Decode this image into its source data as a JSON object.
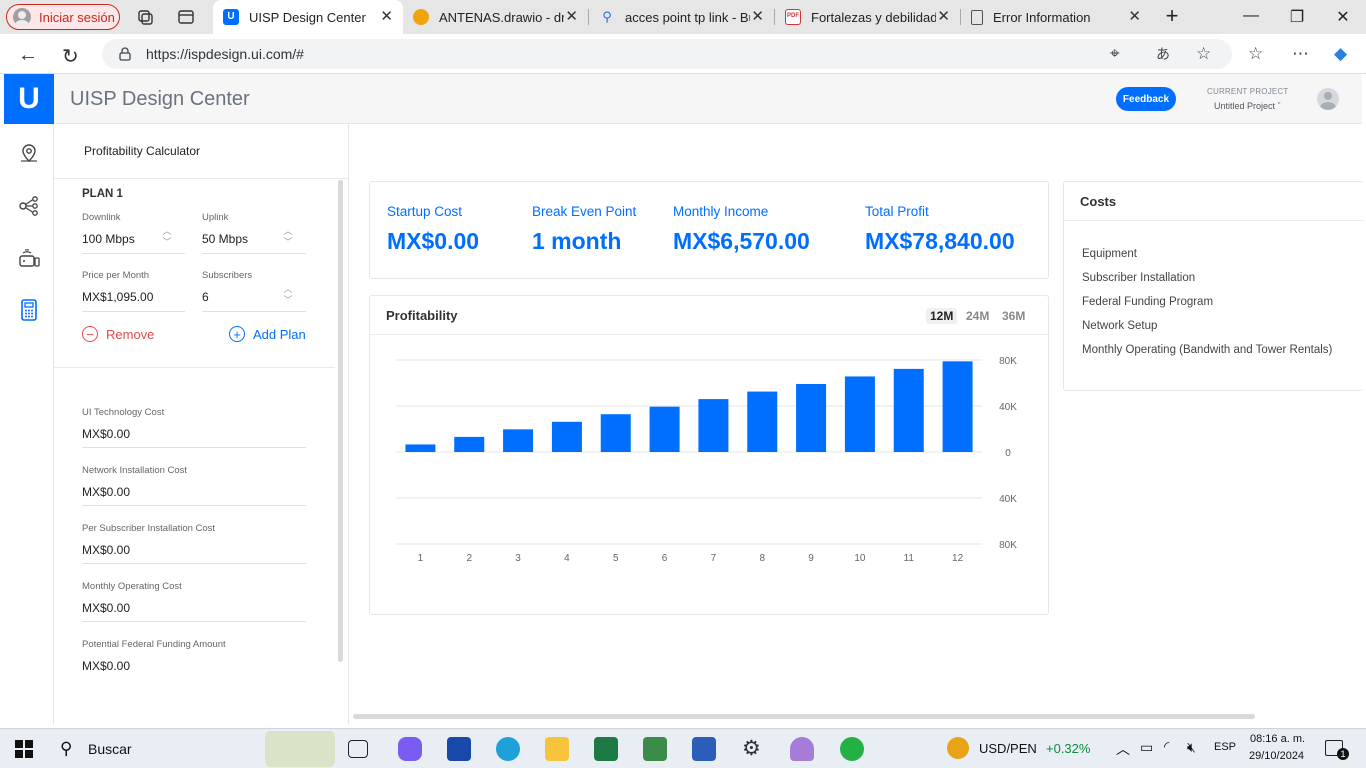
{
  "browser": {
    "profile_label": "Iniciar sesión",
    "tabs": [
      {
        "title": "UISP Design Center",
        "active": true
      },
      {
        "title": "ANTENAS.drawio - draw",
        "active": false
      },
      {
        "title": "acces point tp link - Bús",
        "active": false
      },
      {
        "title": "Fortalezas y debilidades",
        "active": false
      },
      {
        "title": "Error Information",
        "active": false
      }
    ],
    "url": "https://ispdesign.ui.com/#"
  },
  "app": {
    "title": "UISP Design Center",
    "feedback_label": "Feedback",
    "project_caption": "CURRENT PROJECT",
    "project_name": "Untitled Project ˇ"
  },
  "calculator": {
    "title": "Profitability Calculator",
    "plan_title": "PLAN 1",
    "downlink_label": "Downlink",
    "downlink_value": "100 Mbps",
    "uplink_label": "Uplink",
    "uplink_value": "50 Mbps",
    "price_label": "Price per Month",
    "price_value": "MX$1,095.00",
    "subscribers_label": "Subscribers",
    "subscribers_value": "6",
    "remove_label": "Remove",
    "add_label": "Add Plan",
    "costs": [
      {
        "label": "UI Technology Cost",
        "value": "MX$0.00"
      },
      {
        "label": "Network Installation Cost",
        "value": "MX$0.00"
      },
      {
        "label": "Per Subscriber Installation Cost",
        "value": "MX$0.00"
      },
      {
        "label": "Monthly Operating Cost",
        "value": "MX$0.00"
      },
      {
        "label": "Potential Federal Funding Amount",
        "value": "MX$0.00"
      }
    ]
  },
  "summary": {
    "startup_label": "Startup Cost",
    "startup_value": "MX$0.00",
    "breakeven_label": "Break Even Point",
    "breakeven_value": "1 month",
    "income_label": "Monthly Income",
    "income_value": "MX$6,570.00",
    "profit_label": "Total Profit",
    "profit_value": "MX$78,840.00"
  },
  "profitability": {
    "title": "Profitability",
    "ranges": [
      "12M",
      "24M",
      "36M"
    ],
    "active_range": "12M"
  },
  "chart_data": {
    "type": "bar",
    "title": "Profitability",
    "categories": [
      "1",
      "2",
      "3",
      "4",
      "5",
      "6",
      "7",
      "8",
      "9",
      "10",
      "11",
      "12"
    ],
    "values": [
      6570,
      13140,
      19710,
      26280,
      32850,
      39420,
      45990,
      52560,
      59130,
      65700,
      72270,
      78840
    ],
    "ylim": [
      -80000,
      80000
    ],
    "yticks": [
      80000,
      40000,
      0,
      -40000,
      -80000
    ],
    "ytick_labels": [
      "80K",
      "40K",
      "0",
      "40K",
      "80K"
    ],
    "color": "#006fff",
    "grid": true
  },
  "costs_panel": {
    "title": "Costs",
    "items": [
      "Equipment",
      "Subscriber Installation",
      "Federal Funding Program",
      "Network Setup",
      "Monthly Operating (Bandwith and Tower Rentals)"
    ]
  },
  "taskbar": {
    "search_label": "Buscar",
    "currency": "USD/PEN",
    "currency_change": "+0.32%",
    "lang": "ESP",
    "time": "08:16 a. m.",
    "date": "29/10/2024",
    "notif_count": "1"
  },
  "colors": {
    "accent": "#006fff",
    "danger": "#e24b4b",
    "positive": "#0f8a3c"
  }
}
